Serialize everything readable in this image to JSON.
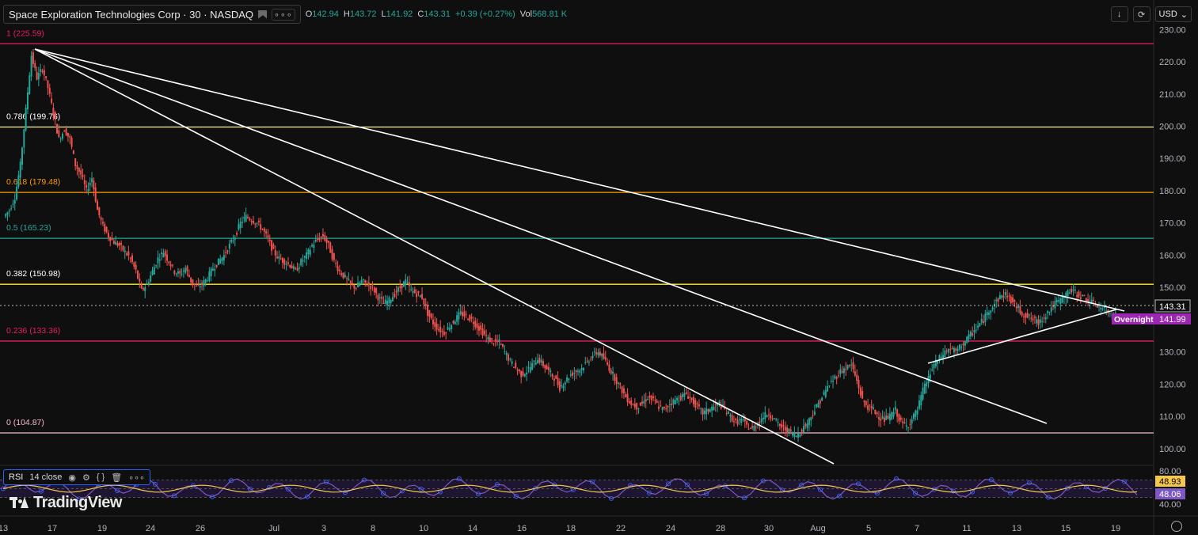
{
  "header": {
    "symbol": "Space Exploration Technologies Corp · 30 · NASDAQ",
    "open_label": "O",
    "open": "142.94",
    "high_label": "H",
    "high": "143.72",
    "low_label": "L",
    "low": "141.92",
    "close_label": "C",
    "close": "143.31",
    "change": "+0.39 (+0.27%)",
    "vol_label": "Vol",
    "volume": "568.81 K",
    "more": "∘∘∘"
  },
  "toolbar": {
    "currency": "USD",
    "currency_icon": "chevron-down-icon"
  },
  "indicator": {
    "name": "RSI",
    "params": "14 close",
    "rsi_value": "48.93",
    "ma_value": "48.06"
  },
  "logo": "TradingView",
  "colors": {
    "up": "#26a69a",
    "down": "#ef5350",
    "rsi_line": "#7e57c2",
    "rsi_ma": "#f5c84c",
    "overnight": "#9c27b0"
  },
  "chart_data": {
    "type": "candlestick",
    "y_ticks": [
      "230.00",
      "220.00",
      "210.00",
      "200.00",
      "190.00",
      "180.00",
      "170.00",
      "160.00",
      "150.00",
      "140.00",
      "130.00",
      "120.00",
      "110.00",
      "100.00"
    ],
    "y_values": [
      230,
      220,
      210,
      200,
      190,
      180,
      170,
      160,
      150,
      140,
      130,
      120,
      110,
      100
    ],
    "ylim": [
      95.3,
      231.3
    ],
    "x_ticks": [
      "13",
      "17",
      "19",
      "24",
      "26",
      "Jul",
      "3",
      "8",
      "10",
      "14",
      "16",
      "18",
      "22",
      "24",
      "28",
      "30",
      "Aug",
      "5",
      "7",
      "11",
      "13",
      "15",
      "19"
    ],
    "fib_levels": [
      {
        "ratio": "1",
        "value": 225.59,
        "label": "1 (225.59)",
        "color": "#e91e63"
      },
      {
        "ratio": "0.786",
        "value": 199.76,
        "label": "0.786 (199.76)",
        "color": "#fff59d"
      },
      {
        "ratio": "0.618",
        "value": 179.48,
        "label": "0.618 (179.48)",
        "color": "#ff9800"
      },
      {
        "ratio": "0.5",
        "value": 165.23,
        "label": "0.5 (165.23)",
        "color": "#26a69a"
      },
      {
        "ratio": "0.382",
        "value": 150.98,
        "label": "0.382 (150.98)",
        "color": "#ffeb3b"
      },
      {
        "ratio": "0.236",
        "value": 133.36,
        "label": "0.236 (133.36)",
        "color": "#e91e63"
      },
      {
        "ratio": "0",
        "value": 104.87,
        "label": "0 (104.87)",
        "color": "#f8bbd0"
      }
    ],
    "close_series": [
      172,
      174,
      178,
      188,
      205,
      222,
      215,
      218,
      212,
      204,
      196,
      199,
      196,
      188,
      185,
      180,
      184,
      174,
      169,
      166,
      164,
      163,
      161,
      159,
      155,
      149,
      151,
      155,
      159,
      161,
      158,
      155,
      154,
      156,
      152,
      150,
      151,
      153,
      156,
      158,
      160,
      163,
      166,
      170,
      172,
      171,
      170,
      168,
      165,
      161,
      159,
      158,
      157,
      155,
      158,
      160,
      163,
      165,
      166,
      163,
      158,
      155,
      153,
      151,
      150,
      152,
      151,
      150,
      147,
      145,
      146,
      148,
      150,
      152,
      149,
      148,
      147,
      142,
      139,
      137,
      136,
      138,
      140,
      142,
      141,
      140,
      138,
      136,
      134,
      133,
      133,
      130,
      127,
      125,
      123,
      124,
      126,
      128,
      126,
      124,
      122,
      119,
      121,
      123,
      124,
      125,
      127,
      129,
      130,
      128,
      125,
      122,
      119,
      116,
      114,
      113,
      114,
      116,
      115,
      113,
      112,
      114,
      115,
      116,
      117,
      115,
      113,
      111,
      112,
      113,
      114,
      112,
      110,
      108,
      109,
      107,
      106,
      108,
      110,
      111,
      109,
      107,
      106,
      105,
      104,
      106,
      108,
      111,
      114,
      117,
      120,
      122,
      124,
      125,
      126,
      121,
      115,
      113,
      112,
      110,
      109,
      110,
      112,
      108,
      107,
      109,
      112,
      118,
      122,
      126,
      128,
      130,
      131,
      130,
      132,
      134,
      136,
      138,
      140,
      143,
      145,
      147,
      148,
      146,
      144,
      142,
      141,
      140,
      139,
      141,
      143,
      145,
      146,
      148,
      149,
      148,
      147,
      146,
      145,
      144,
      143,
      142,
      143
    ]
  }
}
